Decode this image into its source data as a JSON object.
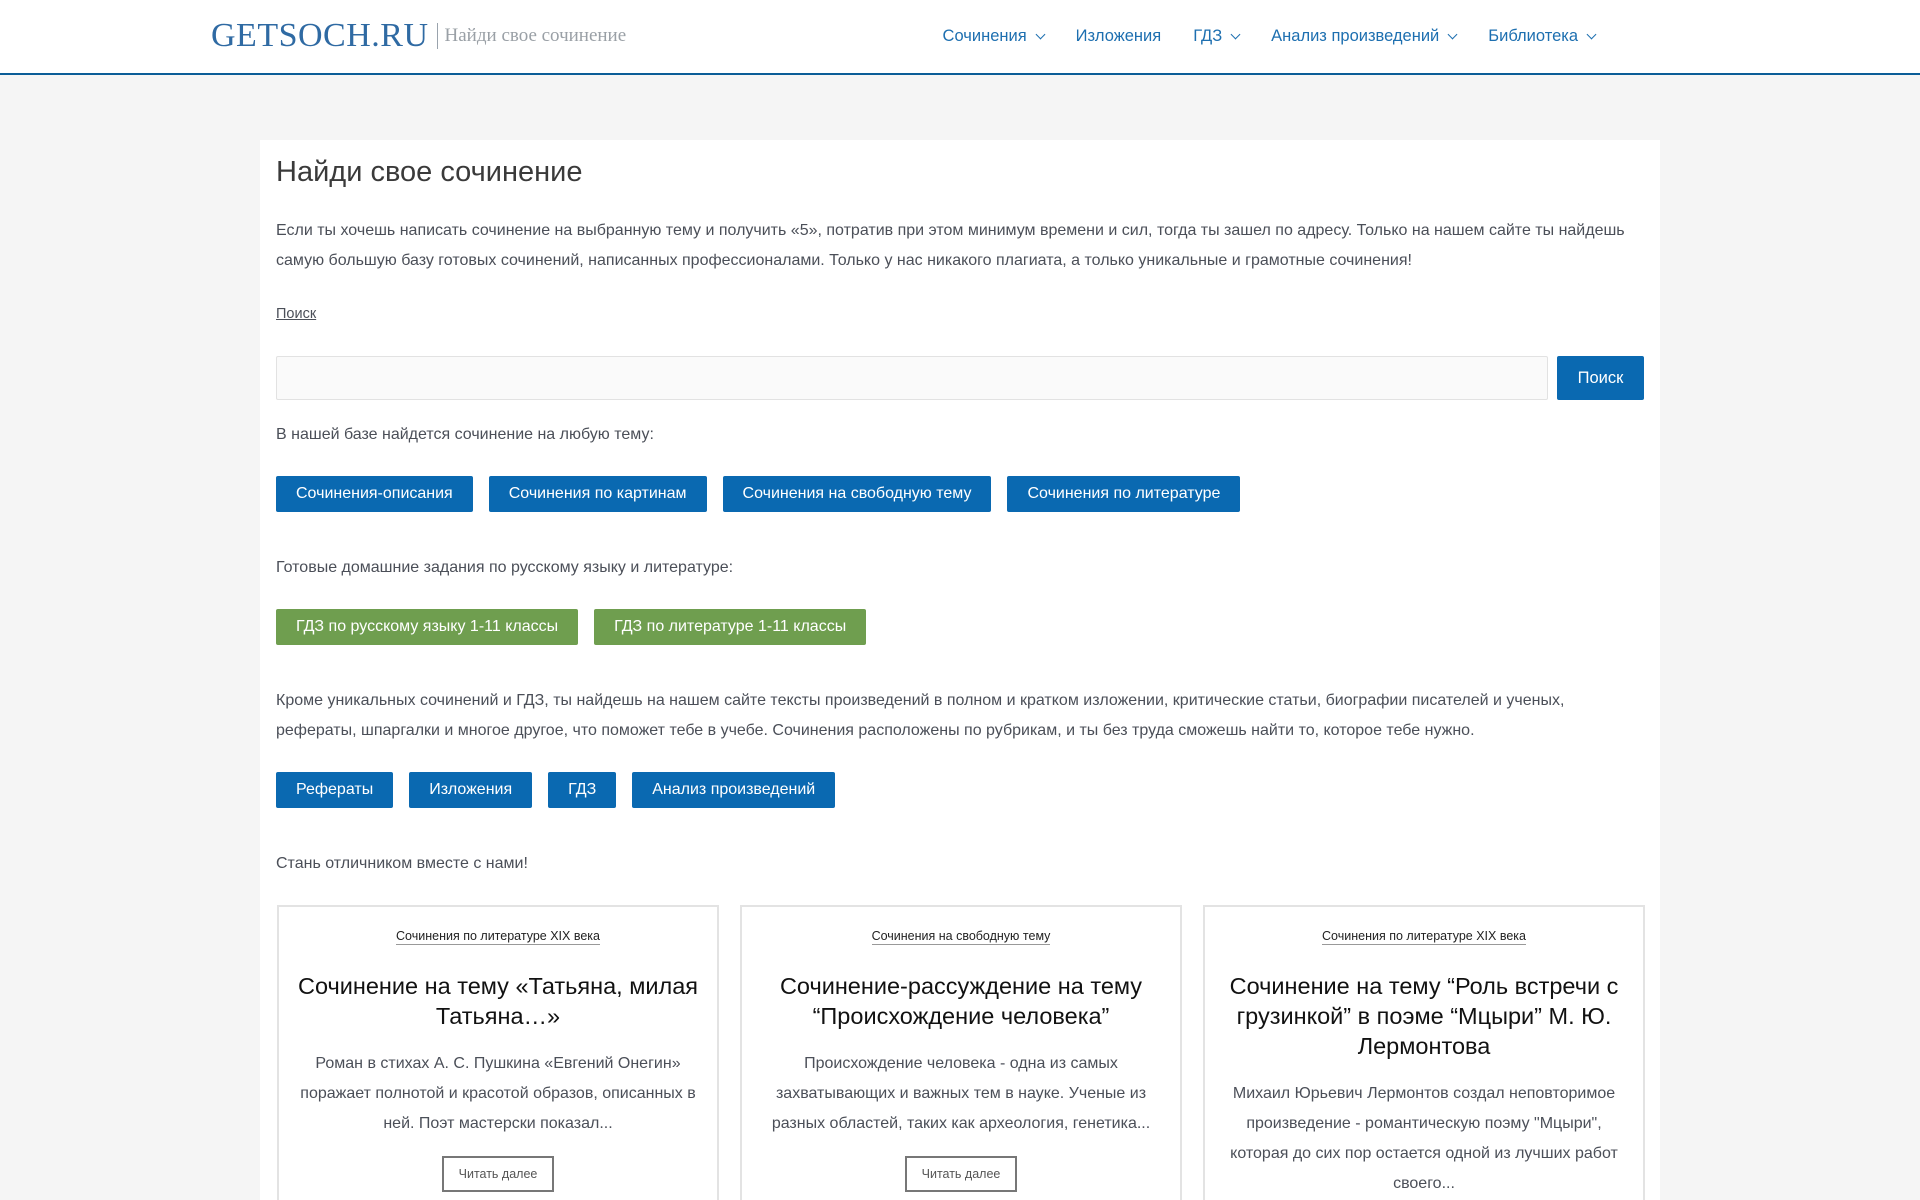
{
  "header": {
    "logo": "GETSOCH.RU",
    "tagline": "Найди свое сочинение",
    "nav": [
      {
        "label": "Сочинения",
        "has_dropdown": true
      },
      {
        "label": "Изложения",
        "has_dropdown": false
      },
      {
        "label": "ГДЗ",
        "has_dropdown": true
      },
      {
        "label": "Анализ произведений",
        "has_dropdown": true
      },
      {
        "label": "Библиотека",
        "has_dropdown": true
      }
    ]
  },
  "main": {
    "title": "Найди свое сочинение",
    "intro": "Если ты хочешь написать сочинение на выбранную тему и получить «5», потратив при этом минимум времени и сил, тогда ты зашел по адресу. Только на нашем сайте ты найдешь самую большую базу готовых сочинений, написанных профессионалами. Только у нас никакого плагиата, а только уникальные и грамотные сочинения!",
    "search": {
      "label": "Поиск",
      "value": "",
      "button": "Поиск"
    },
    "topics_text": "В нашей базе найдется сочинение на любую тему:",
    "topic_buttons": [
      "Сочинения-описания",
      "Сочинения по картинам",
      "Сочинения на свободную тему",
      "Сочинения по литературе"
    ],
    "gdz_text": "Готовые домашние задания по русскому языку и литературе:",
    "gdz_buttons": [
      "ГДЗ по русскому языку 1-11 классы",
      "ГДЗ по литературе 1-11 классы"
    ],
    "extra_text": "Кроме уникальных сочинений и ГДЗ, ты найдешь на нашем сайте тексты произведений в полном и кратком изложении, критические статьи, биографии писателей и ученых, рефераты, шпаргалки и многое другое, что поможет тебе в учебе. Сочинения расположены по рубрикам, и ты без труда сможешь найти то, которое тебе нужно.",
    "extra_buttons": [
      "Рефераты",
      "Изложения",
      "ГДЗ",
      "Анализ произведений"
    ],
    "closing_text": "Стань отличником вместе с нами!",
    "cards": [
      {
        "category": "Сочинения по литературе XIX века",
        "title": "Сочинение на тему «Татьяна, милая Татьяна…»",
        "excerpt": "Роман в стихах А. С. Пушкина «Евгений Онегин» поражает полнотой и красотой образов, описанных в ней. Поэт мастерски показал...",
        "button": "Читать далее"
      },
      {
        "category": "Сочинения на свободную тему",
        "title": "Сочинение-рассуждение на тему “Происхождение человека”",
        "excerpt": "Происхождение человека - одна из самых захватывающих и важных тем в науке. Ученые из разных областей, таких как археология, генетика...",
        "button": "Читать далее"
      },
      {
        "category": "Сочинения по литературе XIX века",
        "title": "Сочинение на тему “Роль встречи с грузинкой” в поэме “Мцыри” М. Ю. Лермонтова",
        "excerpt": "Михаил Юрьевич Лермонтов создал неповторимое произведение - романтическую поэму \"Мцыри\", которая до сих пор остается одной из лучших работ своего...",
        "button": "Читать далее"
      }
    ]
  },
  "colors": {
    "accent": "#0a69b1",
    "green": "#6f9e4f",
    "header_border": "#0b5d97"
  }
}
